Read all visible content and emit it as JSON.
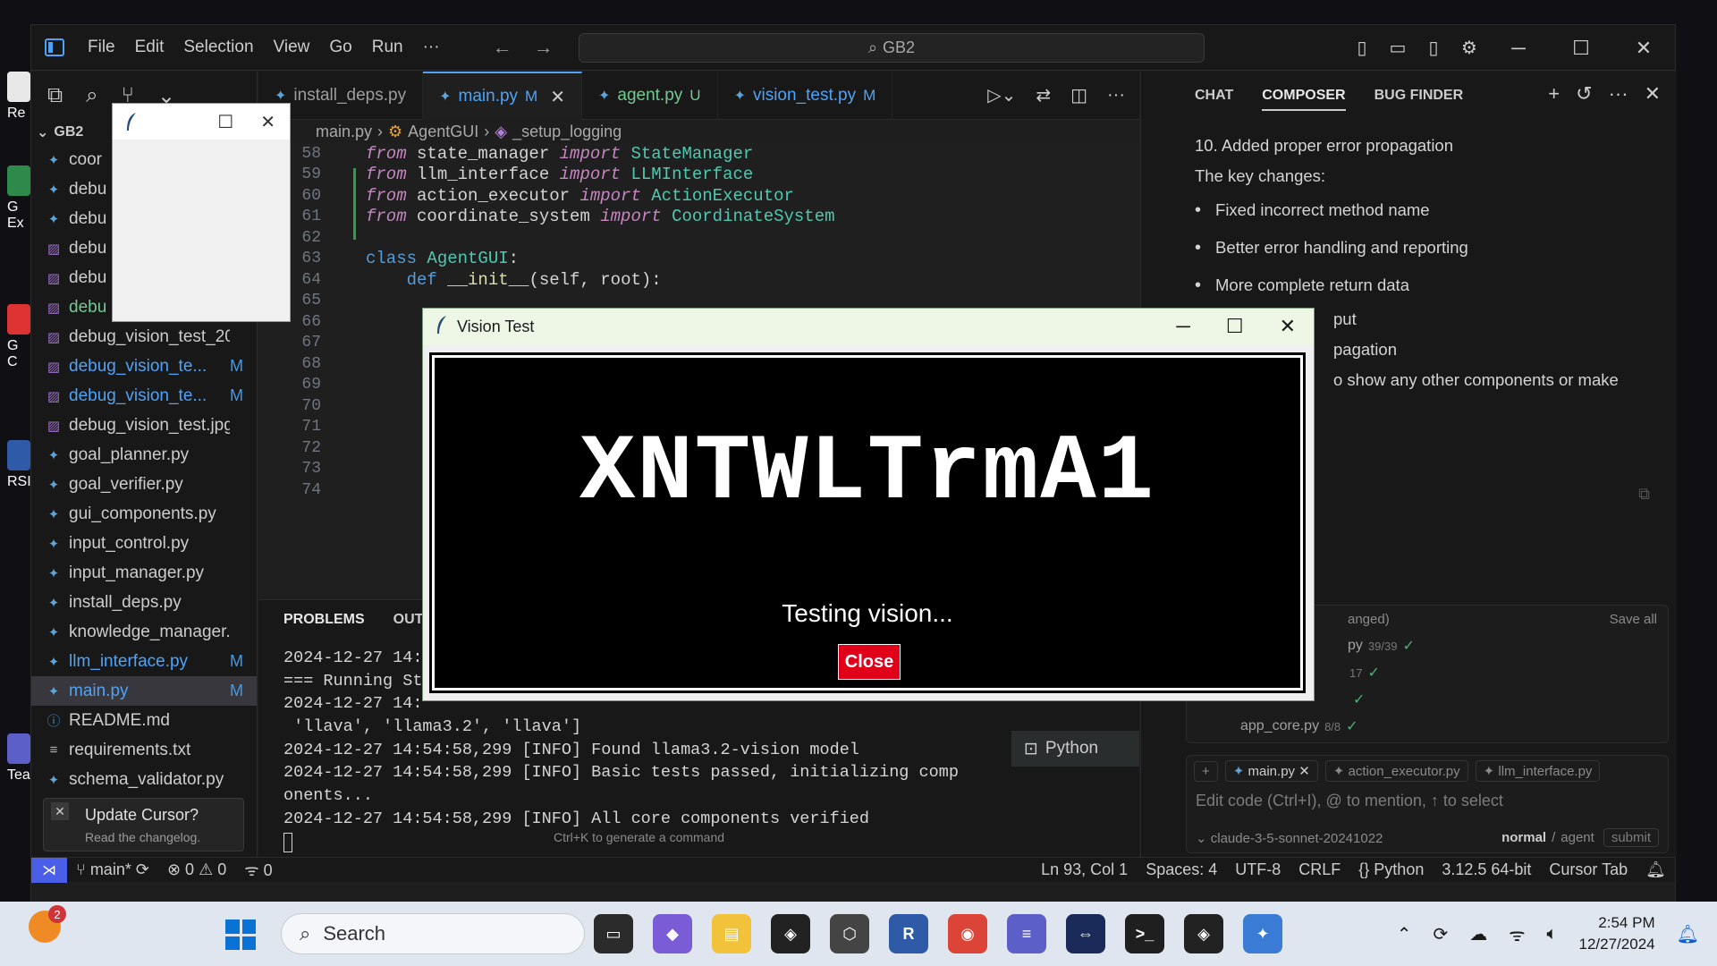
{
  "titlebar": {
    "menu": [
      "File",
      "Edit",
      "Selection",
      "View",
      "Go",
      "Run",
      "···"
    ],
    "search": "GB2"
  },
  "explorer": {
    "root": "GB2",
    "files": [
      {
        "name": "coor",
        "status": "",
        "icon": "py"
      },
      {
        "name": "debu",
        "status": "",
        "icon": "py"
      },
      {
        "name": "debu",
        "status": "",
        "icon": "py"
      },
      {
        "name": "debu",
        "status": "",
        "icon": "img"
      },
      {
        "name": "debu",
        "status": "",
        "icon": "img"
      },
      {
        "name": "debu",
        "status": "",
        "icon": "img"
      },
      {
        "name": "debug_vision_test_20...",
        "status": "",
        "icon": "img"
      },
      {
        "name": "debug_vision_te...",
        "status": "M",
        "icon": "img"
      },
      {
        "name": "debug_vision_te...",
        "status": "M",
        "icon": "img"
      },
      {
        "name": "debug_vision_test.jpg",
        "status": "",
        "icon": "img"
      },
      {
        "name": "goal_planner.py",
        "status": "",
        "icon": "py"
      },
      {
        "name": "goal_verifier.py",
        "status": "",
        "icon": "py"
      },
      {
        "name": "gui_components.py",
        "status": "",
        "icon": "py"
      },
      {
        "name": "input_control.py",
        "status": "",
        "icon": "py"
      },
      {
        "name": "input_manager.py",
        "status": "",
        "icon": "py"
      },
      {
        "name": "install_deps.py",
        "status": "",
        "icon": "py"
      },
      {
        "name": "knowledge_manager.py",
        "status": "",
        "icon": "py"
      },
      {
        "name": "llm_interface.py",
        "status": "M",
        "icon": "py"
      },
      {
        "name": "main.py",
        "status": "M",
        "icon": "py"
      },
      {
        "name": "README.md",
        "status": "",
        "icon": "info"
      },
      {
        "name": "requirements.txt",
        "status": "",
        "icon": "txt"
      },
      {
        "name": "schema_validator.py",
        "status": "",
        "icon": "py"
      }
    ]
  },
  "tabs": [
    {
      "label": "install_deps.py",
      "mark": ""
    },
    {
      "label": "main.py",
      "mark": "M"
    },
    {
      "label": "agent.py",
      "mark": "U"
    },
    {
      "label": "vision_test.py",
      "mark": "M"
    }
  ],
  "breadcrumb": [
    "main.py",
    "AgentGUI",
    "_setup_logging"
  ],
  "code": [
    {
      "n": "58",
      "tokens": [
        [
          "kw",
          "from"
        ],
        [
          "plain",
          " state_manager "
        ],
        [
          "kw",
          "import"
        ],
        [
          "cls",
          " StateManager"
        ]
      ]
    },
    {
      "n": "59",
      "tokens": [
        [
          "kw",
          "from"
        ],
        [
          "plain",
          " llm_interface "
        ],
        [
          "kw",
          "import"
        ],
        [
          "cls",
          " LLMInterface"
        ]
      ]
    },
    {
      "n": "60",
      "tokens": [
        [
          "kw",
          "from"
        ],
        [
          "plain",
          " action_executor "
        ],
        [
          "kw",
          "import"
        ],
        [
          "cls",
          " ActionExecutor"
        ]
      ]
    },
    {
      "n": "61",
      "tokens": [
        [
          "kw",
          "from"
        ],
        [
          "plain",
          " coordinate_system "
        ],
        [
          "kw",
          "import"
        ],
        [
          "cls",
          " CoordinateSystem"
        ]
      ]
    },
    {
      "n": "62",
      "tokens": []
    },
    {
      "n": "63",
      "tokens": [
        [
          "kw2",
          "class"
        ],
        [
          "cls",
          " AgentGUI"
        ],
        [
          "plain",
          ":"
        ]
      ]
    },
    {
      "n": "64",
      "tokens": [
        [
          "plain",
          "    "
        ],
        [
          "kw2",
          "def"
        ],
        [
          "fn",
          " __init__"
        ],
        [
          "plain",
          "(self, root):"
        ]
      ]
    },
    {
      "n": "65",
      "tokens": []
    },
    {
      "n": "66",
      "tokens": []
    },
    {
      "n": "67",
      "tokens": []
    },
    {
      "n": "68",
      "tokens": []
    },
    {
      "n": "69",
      "tokens": []
    },
    {
      "n": "70",
      "tokens": []
    },
    {
      "n": "71",
      "tokens": []
    },
    {
      "n": "72",
      "tokens": []
    },
    {
      "n": "73",
      "tokens": []
    },
    {
      "n": "74",
      "tokens": []
    }
  ],
  "panel": {
    "tabs": [
      "PROBLEMS",
      "OUT"
    ],
    "terminal": [
      "2024-12-27 14:",
      "=== Running St",
      "2024-12-27 14:",
      " 'llava', 'llama3.2', 'llava']",
      "2024-12-27 14:54:58,299 [INFO] Found llama3.2-vision model",
      "2024-12-27 14:54:58,299 [INFO] Basic tests passed, initializing comp",
      "onents...",
      "2024-12-27 14:54:58,299 [INFO] All core components verified"
    ],
    "hint": "Ctrl+K to generate a command",
    "terminal_name": "Python"
  },
  "statusbar": {
    "branch": "main*",
    "errors": "0",
    "warnings": "0",
    "ports": "0",
    "position": "Ln 93, Col 1",
    "spaces": "Spaces: 4",
    "encoding": "UTF-8",
    "eol": "CRLF",
    "language": "Python",
    "interpreter": "3.12.5 64-bit",
    "cursor_tab": "Cursor Tab"
  },
  "composer": {
    "tabs": [
      "CHAT",
      "COMPOSER",
      "BUG FINDER"
    ],
    "line1": "10. Added proper error propagation",
    "line2": "The key changes:",
    "bullets": [
      "Fixed incorrect method name",
      "Better error handling and reporting",
      "More complete return data",
      "",
      ""
    ],
    "tail1": "put",
    "tail2": "pagation",
    "tail3": "o show any other components or make",
    "changes_header": "anged)",
    "save_all": "Save all",
    "change_rows": [
      {
        "name": "py",
        "count": "39/39"
      },
      {
        "name": "",
        "count": "17"
      },
      {
        "name": "",
        "count": ""
      },
      {
        "name": "app_core.py",
        "count": "8/8"
      }
    ],
    "context": [
      "main.py",
      "action_executor.py",
      "llm_interface.py"
    ],
    "placeholder": "Edit code (Ctrl+I), @ to mention, ↑ to select",
    "model": "claude-3-5-sonnet-20241022",
    "mode": "normal",
    "mode2": "agent",
    "submit": "submit"
  },
  "vision_window": {
    "title": "Vision Test",
    "captcha": "XNTWLTrmA1",
    "status": "Testing vision...",
    "close": "Close"
  },
  "toast": {
    "title": "Update Cursor?",
    "body": "Read the changelog."
  },
  "taskbar": {
    "search": "Search",
    "badge": "2",
    "time": "2:54 PM",
    "date": "12/27/2024"
  },
  "desktop": {
    "labels": [
      "Re",
      "G",
      "Ex",
      "G",
      "C",
      "RSI",
      "Tea"
    ]
  }
}
